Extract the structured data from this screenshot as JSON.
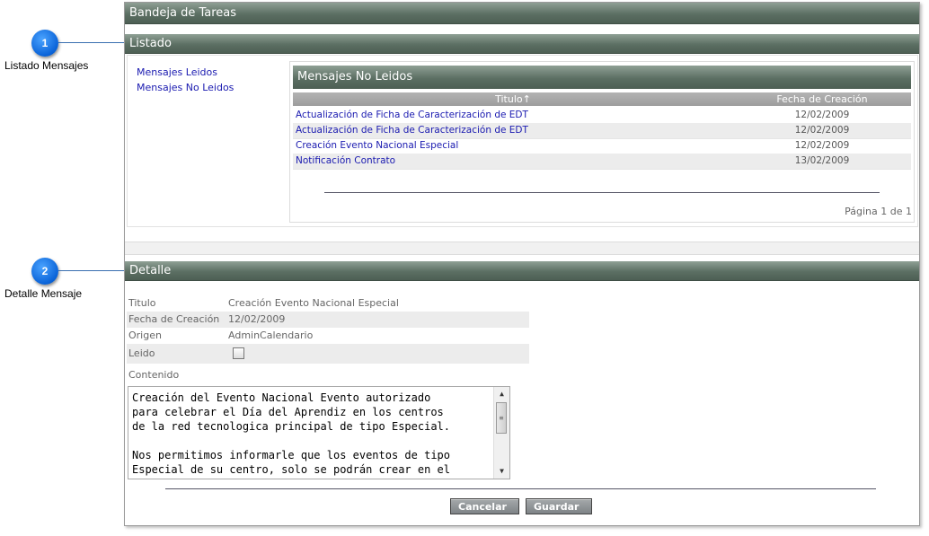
{
  "callouts": [
    {
      "number": "1",
      "label": "Listado Mensajes"
    },
    {
      "number": "2",
      "label": "Detalle Mensaje"
    }
  ],
  "window": {
    "title": "Bandeja de Tareas"
  },
  "listado": {
    "section_title": "Listado",
    "links": [
      "Mensajes Leidos",
      "Mensajes No Leidos"
    ],
    "panel_title": "Mensajes No Leidos",
    "columns": [
      "Titulo↑",
      "Fecha de Creación"
    ],
    "rows": [
      {
        "titulo": "Actualización de Ficha de Caracterización de EDT",
        "fecha": "12/02/2009"
      },
      {
        "titulo": "Actualización de Ficha de Caracterización de EDT",
        "fecha": "12/02/2009"
      },
      {
        "titulo": "Creación Evento Nacional Especial",
        "fecha": "12/02/2009"
      },
      {
        "titulo": "Notificación Contrato",
        "fecha": "13/02/2009"
      }
    ],
    "pager": "Página 1 de 1"
  },
  "detalle": {
    "section_title": "Detalle",
    "fields": {
      "titulo_label": "Titulo",
      "titulo_value": "Creación Evento Nacional Especial",
      "fecha_label": "Fecha de Creación",
      "fecha_value": "12/02/2009",
      "origen_label": "Origen",
      "origen_value": "AdminCalendario",
      "leido_label": "Leido",
      "leido_checked": false
    },
    "contenido_label": "Contenido",
    "contenido_text": "Creación del Evento Nacional Evento autorizado\npara celebrar el Día del Aprendiz en los centros\nde la red tecnologica principal de tipo Especial.\n\nNos permitimos informarle que los eventos de tipo\nEspecial de su centro, solo se podrán crear en el",
    "buttons": {
      "cancel": "Cancelar",
      "save": "Guardar"
    }
  }
}
